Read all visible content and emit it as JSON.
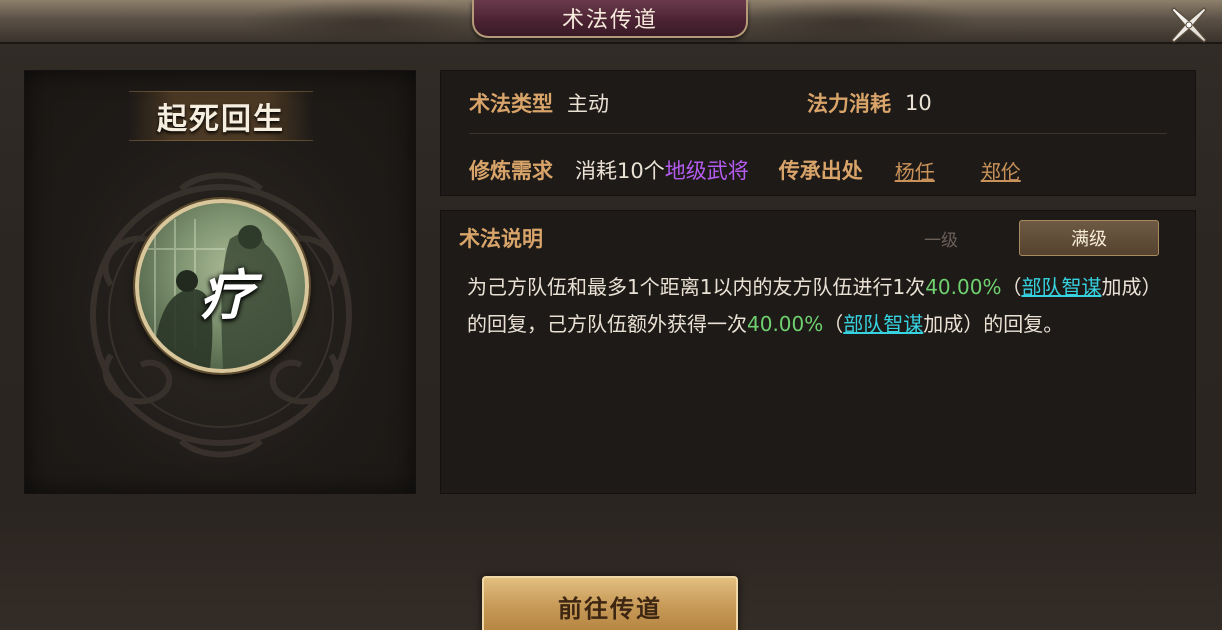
{
  "header": {
    "title": "术法传道",
    "close_icon": "close-x-icon"
  },
  "skill": {
    "name": "起死回生",
    "glyph": "疗",
    "icon": "healing-scholar-portrait"
  },
  "info": {
    "type_label": "术法类型",
    "type_value": "主动",
    "cost_label": "法力消耗",
    "cost_value": "10",
    "req_label": "修炼需求",
    "req_prefix": "消耗10个",
    "req_highlight": "地级武将",
    "source_label": "传承出处",
    "sources": [
      "杨任",
      "郑伦"
    ]
  },
  "description": {
    "title": "术法说明",
    "tabs": [
      "一级",
      "满级"
    ],
    "selected_tab": "满级",
    "segments": [
      "为己方队伍和最多1个距离1以内的友方队伍进行1次",
      "40.00%",
      "（",
      "部队智谋",
      "加成）的回复，己方队伍额外获得一次",
      "40.00%",
      "（",
      "部队智谋",
      "加成）的回复。"
    ]
  },
  "actions": {
    "go_button": "前往传道"
  },
  "colors": {
    "label_gold": "#d8a46a",
    "highlight_purple": "#b35bf0",
    "value_green": "#6fd06f",
    "link_cyan": "#36d2e0",
    "title_plate": "#4a2232"
  }
}
